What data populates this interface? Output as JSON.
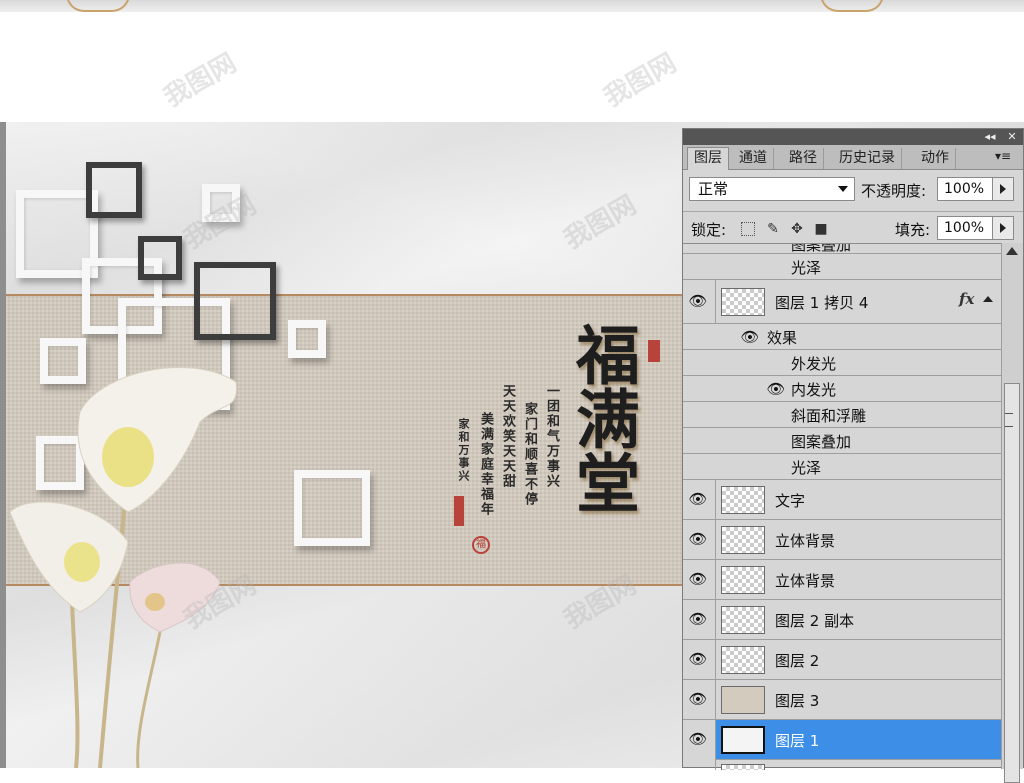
{
  "watermark": "我图网",
  "panel": {
    "tabs": [
      {
        "label": "图层"
      },
      {
        "label": "通道"
      },
      {
        "label": "路径"
      },
      {
        "label": "历史记录"
      },
      {
        "label": "动作"
      }
    ],
    "blend_mode": "正常",
    "opacity_label": "不透明度:",
    "opacity_value": "100%",
    "lock_label": "锁定:",
    "fill_label": "填充:",
    "fill_value": "100%",
    "partial_top_label": "图案叠加",
    "effect_top": "光泽",
    "layer_copy4": "图层 1 拷贝 4",
    "fx_label": "fx",
    "effects_header": "效果",
    "effects": [
      "外发光",
      "内发光",
      "斜面和浮雕",
      "图案叠加",
      "光泽"
    ],
    "layers": [
      "文字",
      "立体背景",
      "立体背景",
      "图层 2 副本",
      "图层 2",
      "图层 3",
      "图层 1"
    ]
  },
  "artwork": {
    "big_chars": "福满堂",
    "poem_col1": "一团和气万事兴",
    "poem_col2": "家门和顺喜不停",
    "poem_col3": "天天欢笑天天甜",
    "poem_col4": "美满家庭幸福年",
    "poem_col5": "家和万事兴",
    "seal_char": "福"
  },
  "colors": {
    "selected_row": "#3d8ee6",
    "band": "#d4cbbf",
    "panel_bg": "#d6d6d6"
  }
}
